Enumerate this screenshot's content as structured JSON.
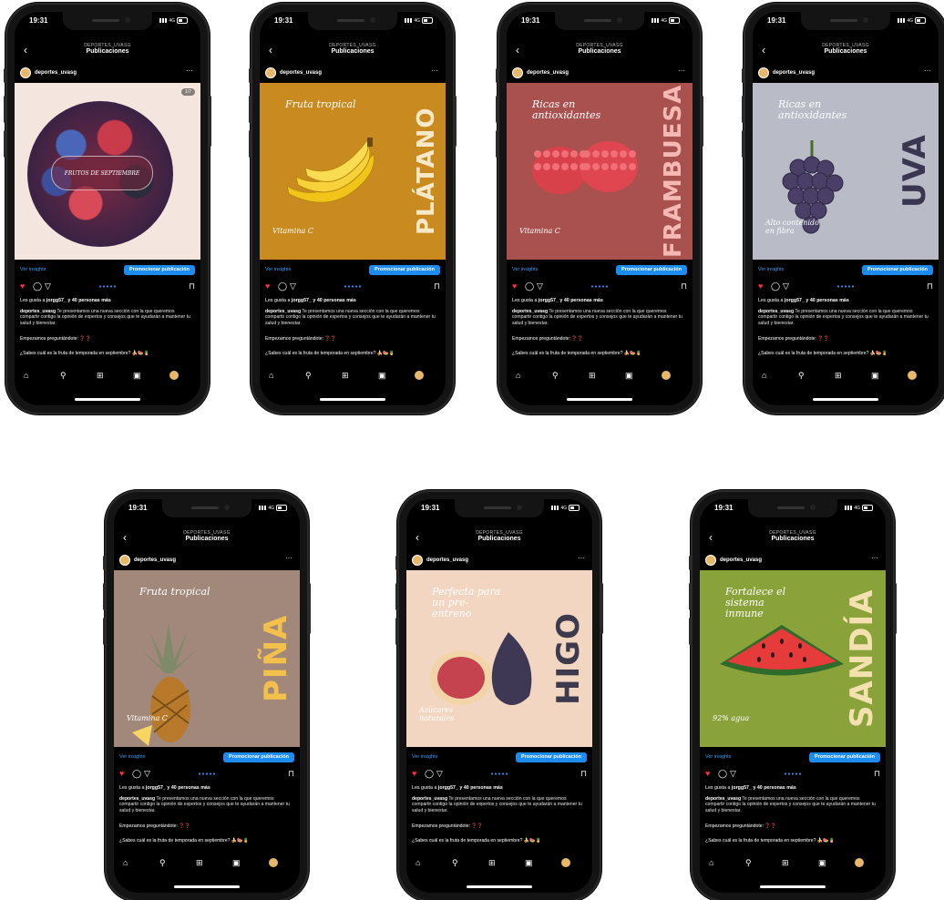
{
  "status": {
    "time": "19:31",
    "network": "4G"
  },
  "header": {
    "account": "DEPORTES_UVASG",
    "title": "Publicaciones"
  },
  "profile": {
    "username": "deportes_uvasg"
  },
  "actions": {
    "insights": "Ver insights",
    "promote": "Promocionar publicación"
  },
  "likes": {
    "prefix": "Les gusta a ",
    "user": "jorgg57_",
    "suffix": " y 40 personas más"
  },
  "caption": {
    "user": "deportes_uvasg",
    "text": " Te presentamos una nueva sección con la que queremos compartir contigo la opinión de expertos y consejos que te ayudarán a mantener tu salud y bienestar.",
    "line2": "Empezamos preguntándote: ❓❓",
    "line3": "¿Sabes cuál es la fruta de temporada en septiembre? 🍌🍉🍍"
  },
  "icons": {
    "back": "back-arrow-icon",
    "more": "more-icon",
    "heart": "heart-icon",
    "comment": "comment-icon",
    "share": "share-icon",
    "save": "bookmark-icon",
    "home": "home-icon",
    "search": "search-icon",
    "create": "add-icon",
    "reels": "reels-icon"
  },
  "posts": [
    {
      "id": "frutos",
      "bg": "#f4e6df",
      "badge": "1/7",
      "banner": "FRUTOS DE SEPTIEMBRE"
    },
    {
      "id": "platano",
      "bg": "#c98a1f",
      "word": "PLÁTANO",
      "word_color": "#f7e9c8",
      "label1": "Fruta tropical",
      "label2": "Vitamina C"
    },
    {
      "id": "frambuesa",
      "bg": "#a8514f",
      "word": "FRAMBUESA",
      "word_color": "#f5b9b3",
      "label1": "Ricas en antioxidantes",
      "label2": "Vitamina C"
    },
    {
      "id": "uva",
      "bg": "#b9bcc6",
      "word": "UVA",
      "word_color": "#3a3550",
      "label1": "Ricas en antioxidantes",
      "label2": "Alto contenido en fibra"
    },
    {
      "id": "pina",
      "bg": "#a2887a",
      "word": "PIÑA",
      "word_color": "#f3c04c",
      "label1": "Fruta tropical",
      "label2": "Vitamina C"
    },
    {
      "id": "higo",
      "bg": "#f3d6c2",
      "word": "HIGO",
      "word_color": "#3c3a4c",
      "label1": "Perfecta para un pre-entreno",
      "label2": "Azúcares naturales"
    },
    {
      "id": "sandia",
      "bg": "#8aa23a",
      "word": "SANDÍA",
      "word_color": "#f3e2b0",
      "label1": "Fortalece el sistema inmune",
      "label2": "92% agua"
    }
  ]
}
